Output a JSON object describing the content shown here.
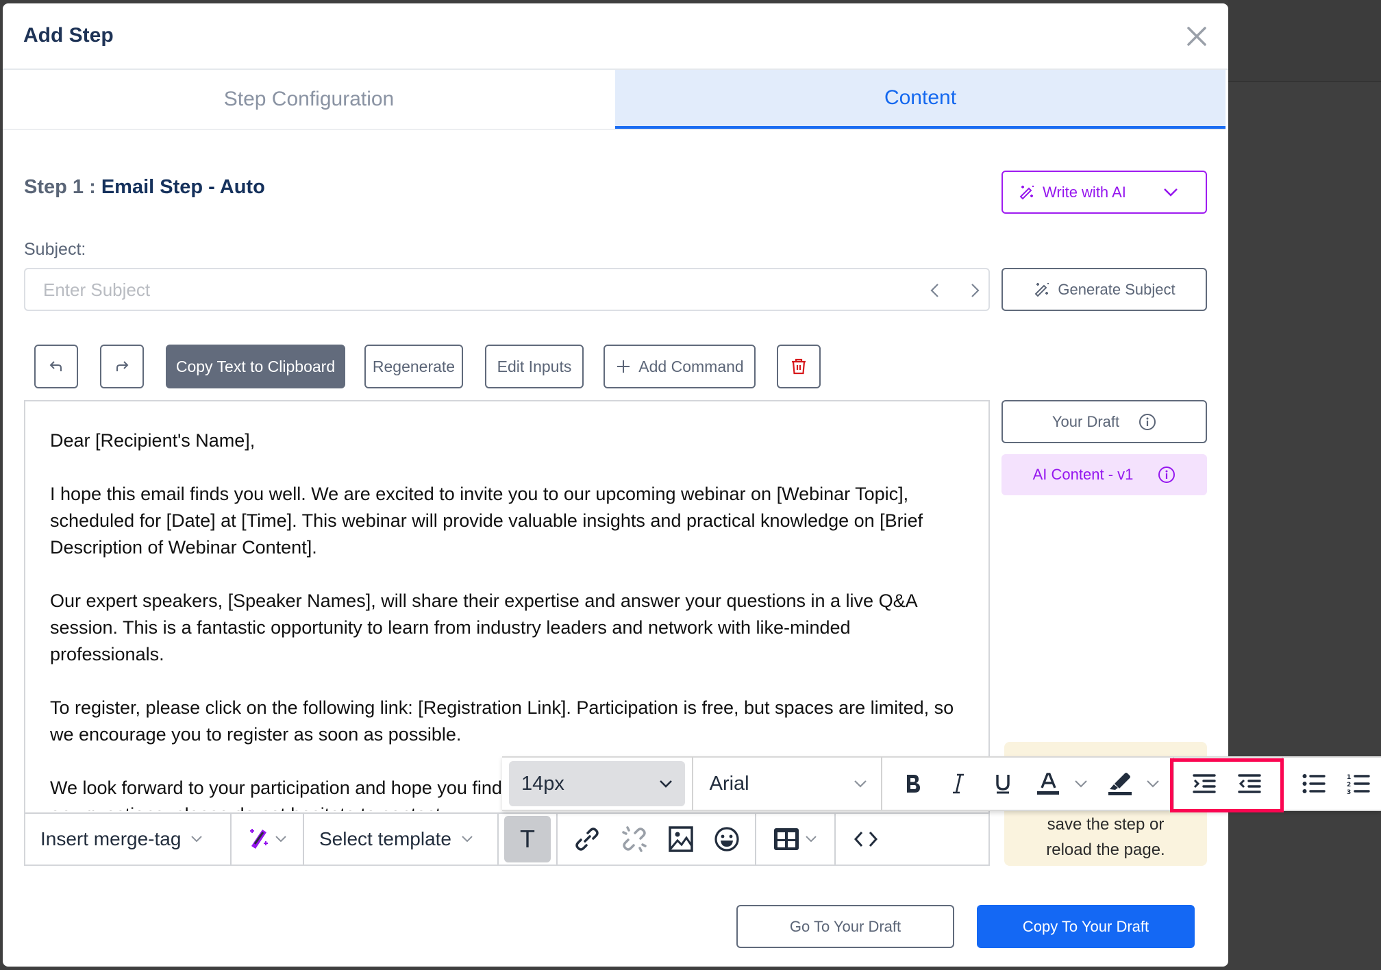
{
  "modal": {
    "title": "Add Step",
    "close_icon": "close-icon"
  },
  "tabs": [
    {
      "label": "Step Configuration",
      "active": false
    },
    {
      "label": "Content",
      "active": true
    }
  ],
  "step": {
    "prefix": "Step 1 : ",
    "name": "Email Step - Auto"
  },
  "write_ai": {
    "label": "Write with AI",
    "icon": "magic-wand-icon",
    "color": "#9515ee"
  },
  "subject": {
    "label": "Subject:",
    "placeholder": "Enter Subject",
    "value": "",
    "generate_label": "Generate Subject"
  },
  "actions": {
    "undo_icon": "undo-icon",
    "redo_icon": "redo-icon",
    "copy_label": "Copy Text to Clipboard",
    "regenerate_label": "Regenerate",
    "edit_inputs_label": "Edit Inputs",
    "add_command_label": "Add Command",
    "delete_icon": "trash-icon"
  },
  "editor": {
    "paragraphs": [
      "Dear [Recipient's Name],",
      "I hope this email finds you well. We are excited to invite you to our upcoming webinar on [Webinar Topic], scheduled for [Date] at [Time]. This webinar will provide valuable insights and practical knowledge on [Brief Description of Webinar Content].",
      "Our expert speakers, [Speaker Names], will share their expertise and answer your questions in a live Q&A session. This is a fantastic opportunity to learn from industry leaders and network with like-minded professionals.",
      "To register, please click on the following link: [Registration Link]. Participation is free, but spaces are limited, so we encourage you to register as soon as possible.",
      "We look forward to your participation and hope you find the webinar both informative and engaging. If you have any questions, please do not hesitate to contact"
    ],
    "bottom_toolbar": {
      "merge_tag_label": "Insert merge-tag",
      "template_label": "Select template"
    }
  },
  "side": {
    "your_draft_label": "Your Draft",
    "ai_content_label": "AI Content - v1",
    "note_lines": [
      "save the step or",
      "reload the page."
    ]
  },
  "format_toolbar": {
    "font_size": "14px",
    "font_family": "Arial"
  },
  "footer": {
    "go_to_draft_label": "Go To Your Draft",
    "copy_to_draft_label": "Copy To Your Draft"
  },
  "colors": {
    "primary": "#1468f4",
    "ai_purple": "#9515ee",
    "highlight": "#fb0551",
    "title": "#1e3356"
  }
}
